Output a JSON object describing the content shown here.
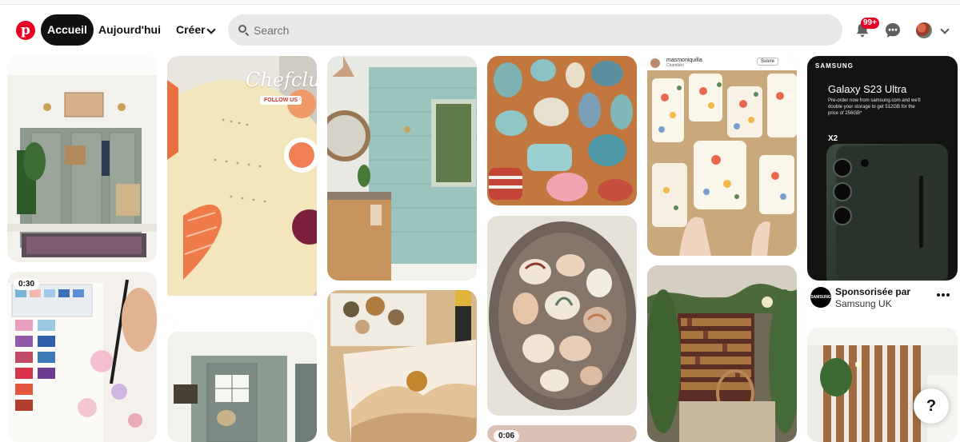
{
  "header": {
    "logo_letter": "p",
    "nav": {
      "home": "Accueil",
      "today": "Aujourd'hui",
      "create": "Créer"
    },
    "search": {
      "placeholder": "Search",
      "value": ""
    },
    "notifications_badge": "99+"
  },
  "colors": {
    "brand": "#e60023",
    "active_pill": "#111111",
    "search_bg": "#e9e9e9"
  },
  "icons": [
    "pinterest-logo",
    "chevron-down-icon",
    "search-icon",
    "bell-icon",
    "chat-icon",
    "avatar",
    "chevron-down-icon",
    "more-icon",
    "help-icon"
  ],
  "pins": {
    "col1_video_duration": "0:30",
    "col4_video_duration": "0:06",
    "chefclub": {
      "brand": "Chefclub",
      "tag": "FOLLOW US"
    },
    "instagram": {
      "user": "masmoniquilla",
      "location": "Chambéri",
      "follow": "Suivre"
    },
    "samsung_ad": {
      "brand": "SAMSUNG",
      "title": "Galaxy S23 Ultra",
      "subtitle": "Pre-order now from samsung.com and we'll double your storage to get 512GB for the price of 256GB*",
      "storage": "X2"
    }
  },
  "sponsor": {
    "label": "Sponsorisée par",
    "name": "Samsung UK",
    "logo_text": "SAMSUNG"
  },
  "help": {
    "label": "?"
  }
}
